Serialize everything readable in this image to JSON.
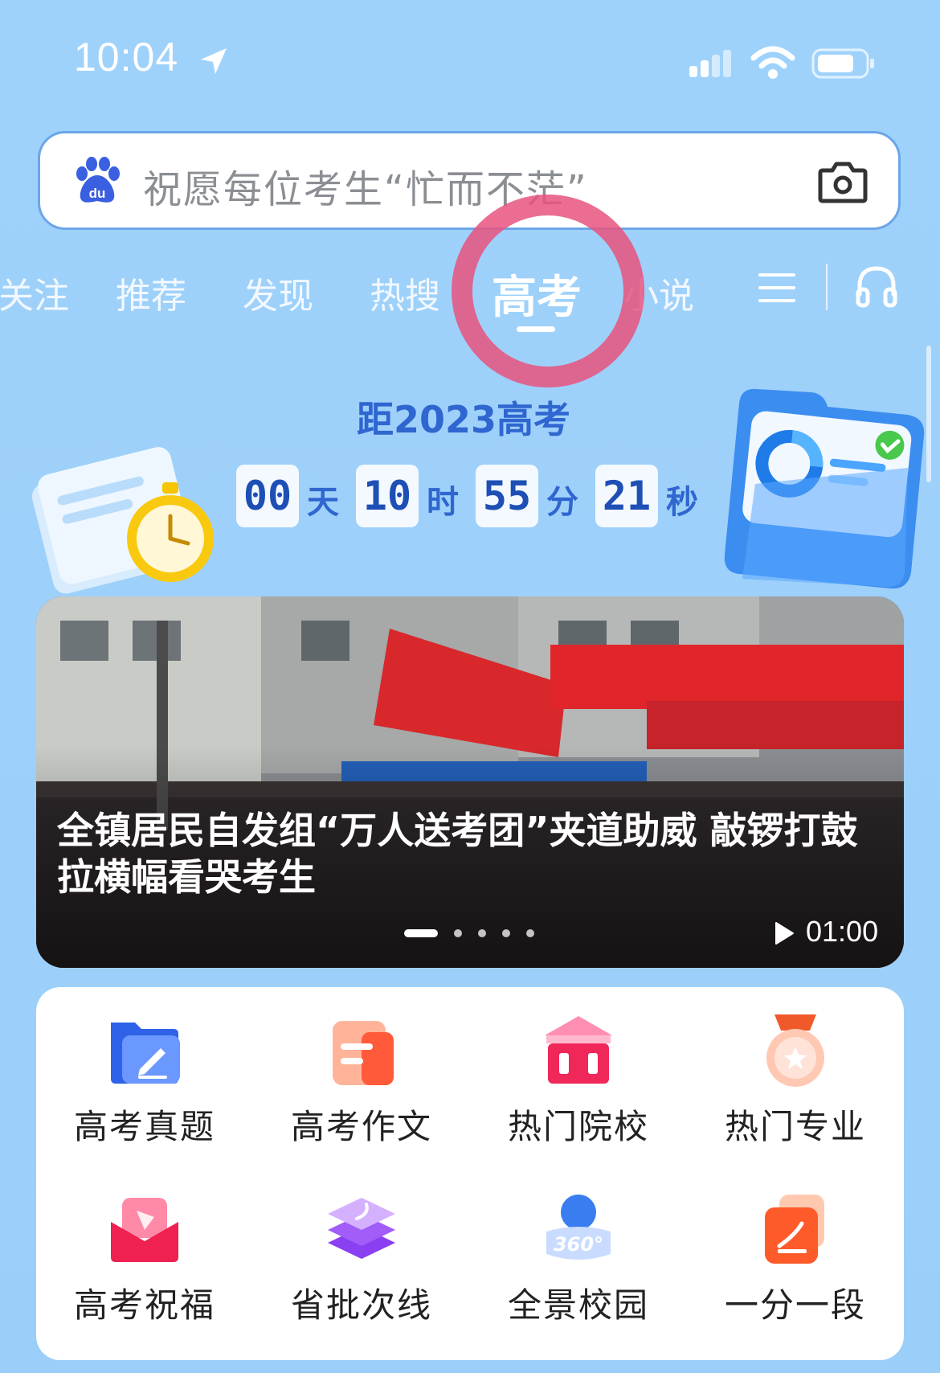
{
  "status_bar": {
    "time": "10:04"
  },
  "search": {
    "placeholder": "祝愿每位考生“忙而不茫”"
  },
  "tabs": [
    {
      "label": "关注"
    },
    {
      "label": "推荐"
    },
    {
      "label": "发现"
    },
    {
      "label": "热搜"
    },
    {
      "label": "高考",
      "active": true
    },
    {
      "label": "小说"
    }
  ],
  "countdown": {
    "title": "距2023高考",
    "days": "00",
    "days_unit": "天",
    "hours": "10",
    "hours_unit": "时",
    "minutes": "55",
    "minutes_unit": "分",
    "seconds": "21",
    "seconds_unit": "秒"
  },
  "banner": {
    "headline": "全镇居民自发组“万人送考团”夹道助威 敲锣打鼓拉横幅看哭考生",
    "duration": "01:00",
    "dots_total": 5,
    "dots_active": 1
  },
  "grid": [
    {
      "label": "高考真题",
      "icon": "folder-pen-icon"
    },
    {
      "label": "高考作文",
      "icon": "document-icon"
    },
    {
      "label": "热门院校",
      "icon": "school-building-icon"
    },
    {
      "label": "热门专业",
      "icon": "medal-icon"
    },
    {
      "label": "高考祝福",
      "icon": "envelope-icon"
    },
    {
      "label": "省批次线",
      "icon": "layers-icon"
    },
    {
      "label": "全景校园",
      "icon": "panorama-360-icon"
    },
    {
      "label": "一分一段",
      "icon": "score-card-icon"
    }
  ],
  "colors": {
    "accent": "#2f66d0",
    "background": "#9fd2fb",
    "highlight": "#e8547e"
  }
}
